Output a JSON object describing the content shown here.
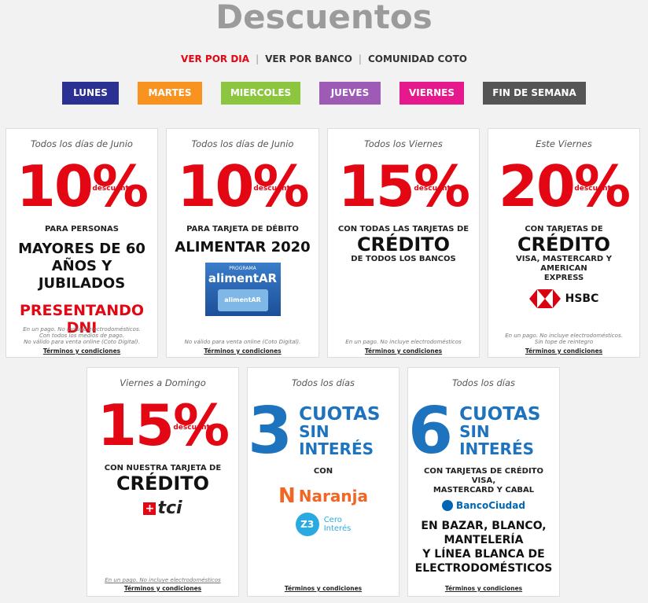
{
  "page": {
    "title": "Descuentos"
  },
  "subnav": {
    "items": [
      "VER POR DIA",
      "VER POR BANCO",
      "COMUNIDAD COTO"
    ],
    "separator": "|"
  },
  "days": [
    {
      "label": "LUNES",
      "color": "#2b3192"
    },
    {
      "label": "MARTES",
      "color": "#f7931e"
    },
    {
      "label": "MIERCOLES",
      "color": "#8cc63f"
    },
    {
      "label": "JUEVES",
      "color": "#9e5bb5"
    },
    {
      "label": "VIERNES",
      "color": "#e5198c"
    },
    {
      "label": "FIN DE SEMANA",
      "color": "#555555"
    }
  ],
  "cards": {
    "c1": {
      "when": "Todos los días de Junio",
      "pct": "10%",
      "desc": "descuento",
      "l1": "PARA PERSONAS",
      "l2": "MAYORES DE 60",
      "l3": "AÑOS Y JUBILADOS",
      "l4": "PRESENTANDO DNI",
      "f1": "En un pago. No incluye electrodomésticos.",
      "f2": "Con todos los medios de pago.",
      "f3": "No válido para venta online (Coto Digital).",
      "terms": "Términos y condiciones"
    },
    "c2": {
      "when": "Todos los días de Junio",
      "pct": "10%",
      "desc": "descuento",
      "l1": "PARA TARJETA DE DÉBITO",
      "l2": "ALIMENTAR 2020",
      "logo_top": "PROGRAMA",
      "logo_mid": "alimentAR",
      "logo_card": "alimentAR",
      "f1": "No válido para venta online (Coto Digital).",
      "terms": "Términos y condiciones"
    },
    "c3": {
      "when": "Todos los Viernes",
      "pct": "15%",
      "desc": "descuento",
      "l1": "CON TODAS LAS TARJETAS DE",
      "l2": "CRÉDITO",
      "l3": "DE TODOS LOS BANCOS",
      "f1": "En un pago. No incluye electrodomésticos",
      "terms": "Términos y condiciones"
    },
    "c4": {
      "when": "Este Viernes",
      "pct": "20%",
      "desc": "descuento",
      "l1": "CON TARJETAS DE",
      "l2": "CRÉDITO",
      "l3": "VISA, MASTERCARD Y AMERICAN",
      "l4": "EXPRESS",
      "logo": "HSBC",
      "f1": "En un pago. No incluye electrodomésticos.",
      "f2": "Sin tope de reintegro",
      "terms": "Términos y condiciones"
    },
    "c5": {
      "when": "Viernes a Domingo",
      "pct": "15%",
      "desc": "descuento",
      "l1": "CON NUESTRA TARJETA DE",
      "l2": "CRÉDITO",
      "logo": "tci",
      "f1": "En un pago. No incluye electrodomésticos",
      "terms": "Términos y condiciones"
    },
    "c6": {
      "when": "Todos los días",
      "num": "3",
      "t1": "CUOTAS",
      "t2": "SIN INTERÉS",
      "l1": "CON",
      "logo1": "Naranja",
      "logo2_badge": "Z3",
      "logo2_a": "Cero",
      "logo2_b": "Interés",
      "terms": "Términos y condiciones"
    },
    "c7": {
      "when": "Todos los días",
      "num": "6",
      "t1": "CUOTAS",
      "t2": "SIN INTERÉS",
      "l1": "CON TARJETAS DE CRÉDITO VISA,",
      "l2": "MASTERCARD Y CABAL",
      "logo": "BancoCiudad",
      "l3": "EN BAZAR, BLANCO,",
      "l4": "MANTELERÍA",
      "l5": "Y LÍNEA BLANCA DE",
      "l6": "ELECTRODOMÉSTICOS",
      "terms": "Términos y condiciones"
    }
  }
}
